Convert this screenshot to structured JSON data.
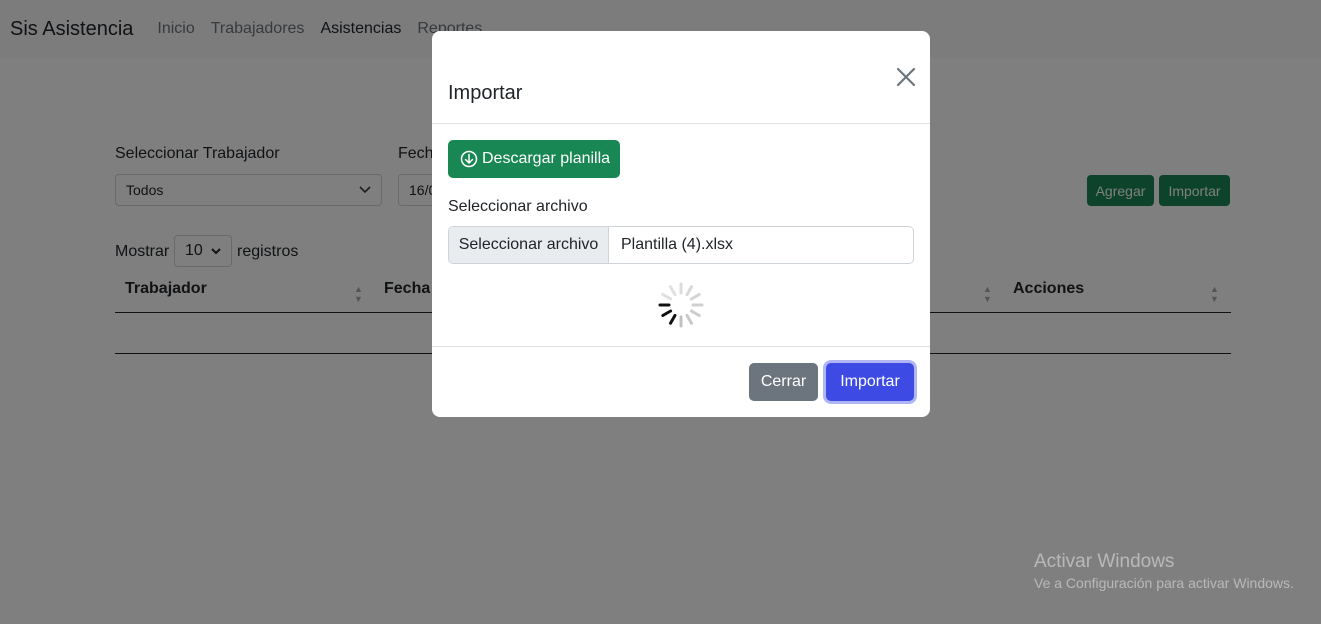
{
  "navbar": {
    "brand": "Sis Asistencia",
    "items": [
      {
        "label": "Inicio",
        "active": false
      },
      {
        "label": "Trabajadores",
        "active": false
      },
      {
        "label": "Asistencias",
        "active": true
      },
      {
        "label": "Reportes",
        "active": false
      }
    ]
  },
  "filters": {
    "worker_label": "Seleccionar Trabajador",
    "worker_value": "Todos",
    "date_label": "Fecha",
    "date_value": "16/0"
  },
  "actions": {
    "add": "Agregar",
    "import": "Importar"
  },
  "pagination": {
    "show_label": "Mostrar",
    "page_size": "10",
    "records_label": "registros"
  },
  "table": {
    "columns": [
      "Trabajador",
      "Fecha",
      "Acciones"
    ]
  },
  "modal": {
    "title": "Importar",
    "download_button": "Descargar planilla",
    "file_label": "Seleccionar archivo",
    "file_button": "Seleccionar archivo",
    "file_name": "Plantilla (4).xlsx",
    "close_button": "Cerrar",
    "submit_button": "Importar"
  },
  "watermark": {
    "line1": "Activar Windows",
    "line2": "Ve a Configuración para activar Windows."
  },
  "colors": {
    "success": "#198754",
    "primary": "#3d4ae3",
    "secondary": "#6c757d"
  }
}
